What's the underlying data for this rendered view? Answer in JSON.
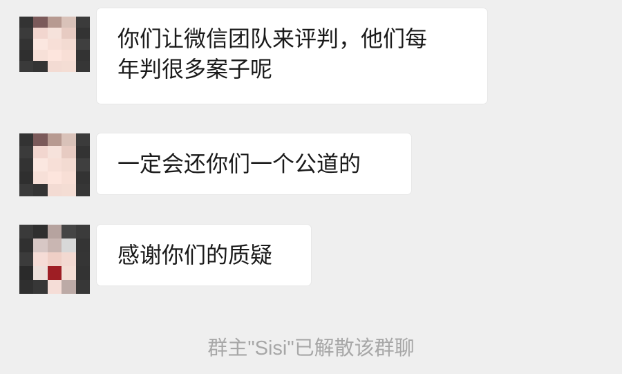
{
  "messages": [
    {
      "text": "你们让微信团队来评判，他们每\n年判很多案子呢"
    },
    {
      "text": "一定会还你们一个公道的"
    },
    {
      "text": "感谢你们的质疑"
    }
  ],
  "system_note": "群主\"Sisi\"已解散该群聊",
  "colors": {
    "background": "#efefef",
    "bubble": "#ffffff",
    "text": "#1a1a1a",
    "system_text": "#a7a7a7"
  }
}
